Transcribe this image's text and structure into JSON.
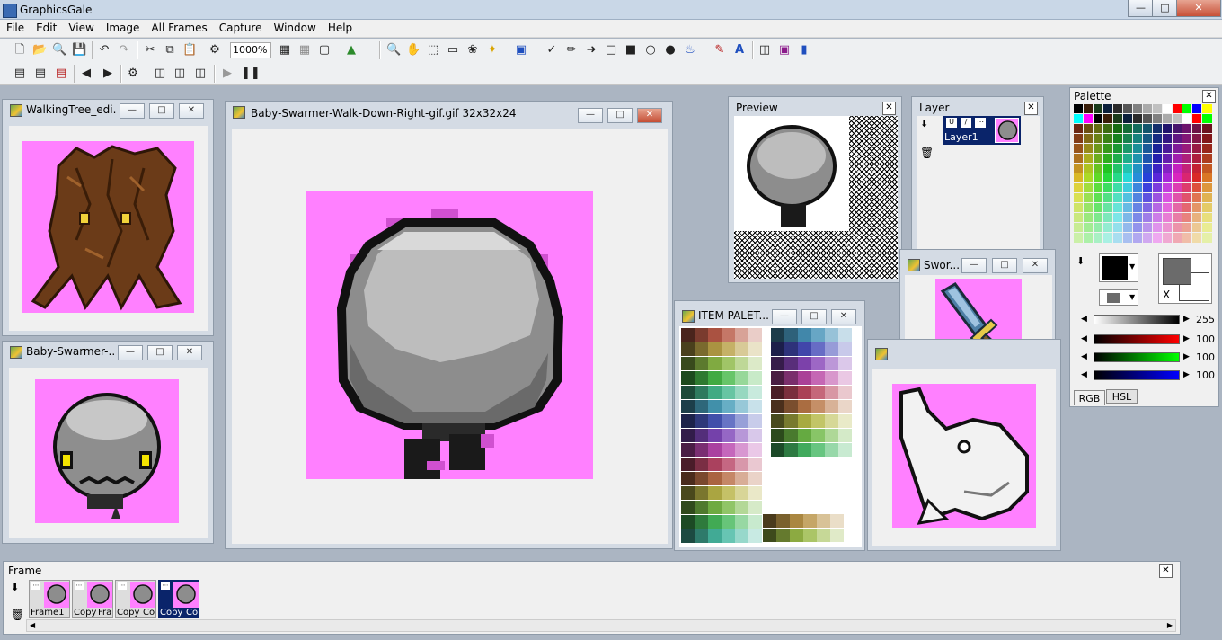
{
  "app": {
    "title": "GraphicsGale"
  },
  "menu": [
    "File",
    "Edit",
    "View",
    "Image",
    "All Frames",
    "Capture",
    "Window",
    "Help"
  ],
  "toolbar": {
    "zoom": "1000%"
  },
  "windows": {
    "walking_tree": {
      "title": "WalkingTree_edi..."
    },
    "baby_swarmer_small": {
      "title": "Baby-Swarmer-..."
    },
    "baby_swarmer_main": {
      "title": "Baby-Swarmer-Walk-Down-Right-gif.gif 32x32x24"
    },
    "item_palette": {
      "title": "ITEM PALET..."
    },
    "sword": {
      "title": "Swor..."
    }
  },
  "panels": {
    "preview": {
      "title": "Preview"
    },
    "layer": {
      "title": "Layer",
      "layer_name": "Layer1"
    },
    "palette": {
      "title": "Palette",
      "values": [
        "255",
        "100",
        "100",
        "100"
      ],
      "tabs": [
        "RGB",
        "HSL"
      ],
      "transparent_label": "X"
    },
    "frame": {
      "title": "Frame",
      "frames": [
        "Frame1",
        "Copy",
        "Fra",
        "Copy",
        "Co",
        "Copy",
        "Co"
      ]
    }
  },
  "colors": {
    "canvas_bg": "#ff80ff",
    "selected_frame": "#0a246a"
  },
  "icons": {
    "close": "close-icon",
    "minimize": "minimize-icon",
    "maximize": "maximize-icon"
  }
}
